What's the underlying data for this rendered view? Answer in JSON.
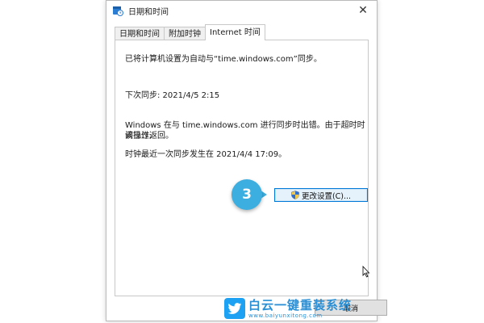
{
  "window": {
    "title": "日期和时间",
    "close_glyph": "✕"
  },
  "tabs": [
    {
      "label": "日期和时间",
      "active": false
    },
    {
      "label": "附加时钟",
      "active": false
    },
    {
      "label": "Internet 时间",
      "active": true
    }
  ],
  "panel": {
    "sync_status": "已将计算机设置为自动与“time.windows.com”同步。",
    "next_sync": "下次同步: 2021/4/5 2:15",
    "error_line1": "Windows 在与 time.windows.com 进行同步时出错。由于超时时间已过,",
    "error_line2": "该操作返回。",
    "last_sync": "时钟最近一次同步发生在 2021/4/4 17:09。",
    "change_button_label": "更改设置(C)..."
  },
  "annotation": {
    "step_number": "3"
  },
  "footer": {
    "cancel_label": "取消"
  },
  "watermark": {
    "title": "白云一键重装系统",
    "url": "www.baiyunxitong.com"
  },
  "colors": {
    "accent": "#0078d7",
    "step_badge": "#3daee0",
    "watermark": "#2a8fd4"
  },
  "icons": {
    "title": "calendar-clock-icon",
    "button": "uac-shield-icon",
    "watermark": "twitter-bird-icon"
  }
}
